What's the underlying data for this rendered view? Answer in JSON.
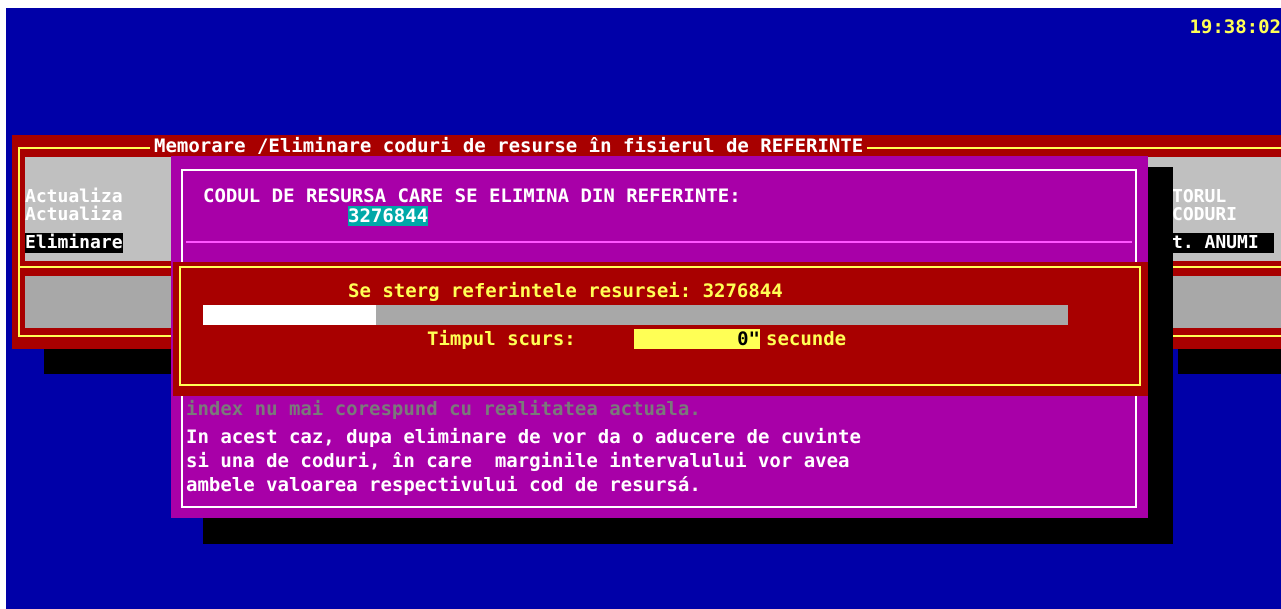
{
  "clock": "19:38:02",
  "panel": {
    "title": "Memorare /Eliminare coduri de resurse în fisierul de REFERINTE",
    "menu_left": [
      "Actualiza",
      "Actualiza",
      "Eliminare"
    ],
    "menu_right": [
      "TORUL",
      "CODURI",
      "t. ANUMI"
    ]
  },
  "dialog": {
    "prompt": "CODUL DE RESURSA CARE SE ELIMINA DIN REFERINTE:",
    "code": "3276844",
    "info_lines": [
      "index nu mai corespund cu realitatea actuala.",
      "In acest caz, dupa eliminare de vor da o aducere de cuvinte",
      "si una de coduri, în care  marginile intervalului vor avea",
      "ambele valoarea respectivului cod de resursá."
    ]
  },
  "progress": {
    "label": "Se sterg referintele resursei: 3276844",
    "fraction": 0.2,
    "time_label": "Timpul scurs:",
    "time_value": "0\"",
    "time_unit": "secunde"
  },
  "colors": {
    "screen_bg": "#0000a8",
    "dialog_bg": "#a800a8",
    "panel_bg": "#a80000",
    "highlight": "#ffff55",
    "code_bg": "#00a8a8"
  }
}
